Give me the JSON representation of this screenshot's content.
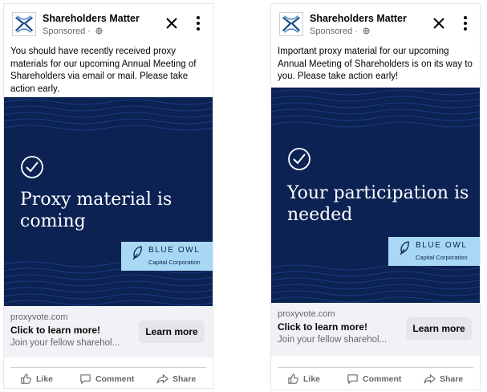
{
  "ads": [
    {
      "page_name": "Shareholders Matter",
      "sponsored": "Sponsored ·",
      "body": "You should have recently received proxy materials for our upcoming Annual Meeting of Shareholders via email or mail. Please take action early.",
      "headline": "Proxy material is coming",
      "brand_name": "BLUE OWL",
      "brand_sub": "Capital Corporation",
      "domain": "proxyvote.com",
      "cta_title": "Click to learn more!",
      "cta_desc": "Join your fellow sharehol...",
      "cta_button": "Learn more",
      "like": "Like",
      "comment": "Comment",
      "share": "Share"
    },
    {
      "page_name": "Shareholders Matter",
      "sponsored": "Sponsored ·",
      "body": "Important proxy material for our upcoming Annual Meeting of Shareholders is on its way to you. Please take action early!",
      "headline": "Your participation is needed",
      "brand_name": "BLUE OWL",
      "brand_sub": "Capital Corporation",
      "domain": "proxyvote.com",
      "cta_title": "Click to learn more!",
      "cta_desc": "Join your fellow sharehol...",
      "cta_button": "Learn more",
      "like": "Like",
      "comment": "Comment",
      "share": "Share"
    }
  ],
  "icons": [
    "globe-icon",
    "close-icon",
    "more-options-icon",
    "checkmark-circle-icon",
    "feather-icon",
    "like-icon",
    "comment-icon",
    "share-icon"
  ],
  "colors": {
    "navy": "#0b2253",
    "badge": "#a9d8f5",
    "muted": "#65676b",
    "button_bg": "#e4e6eb",
    "footer_bg": "#f0f2f5"
  }
}
